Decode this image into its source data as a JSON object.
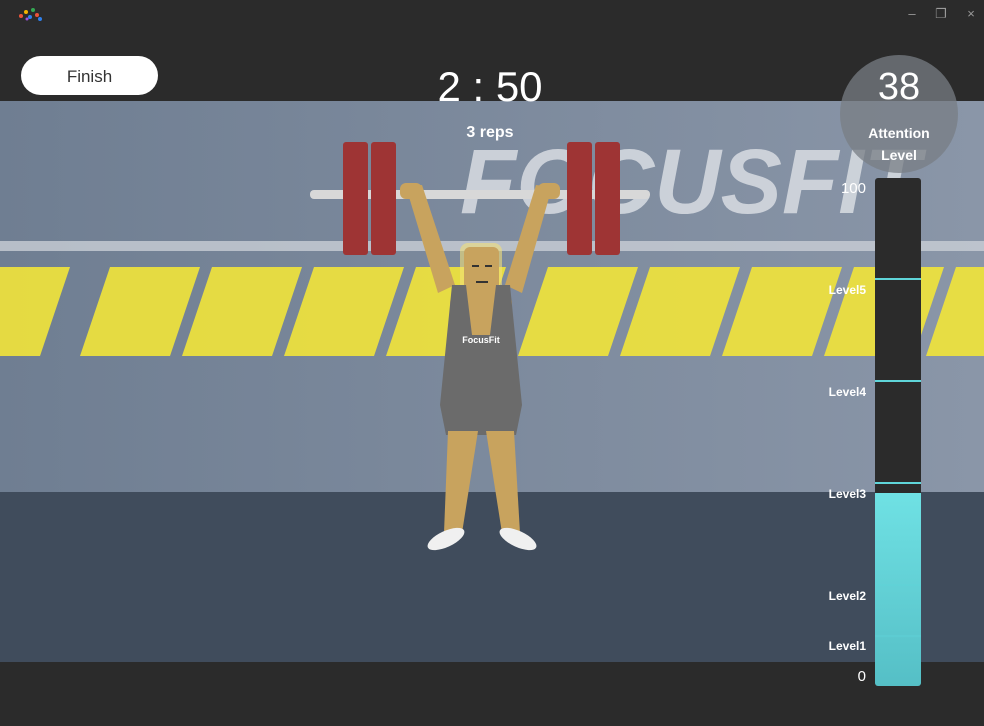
{
  "window": {
    "minimize_glyph": "–",
    "restore_glyph": "❐",
    "close_glyph": "×"
  },
  "game": {
    "finish_label": "Finish",
    "timer": "2 : 50",
    "reps": "3 reps",
    "banner_text": "FOCUSFIT",
    "shirt_text": "FocusFit"
  },
  "attention": {
    "value": "38",
    "label_line1": "Attention",
    "label_line2": "Level",
    "meter_fill_fraction": 0.38,
    "scale_max": "100",
    "scale_min": "0",
    "levels": [
      "Level5",
      "Level4",
      "Level3",
      "Level2",
      "Level1"
    ]
  },
  "colors": {
    "accent": "#6fe1e4",
    "plate": "#9e3434",
    "stripe": "#f2e53a",
    "skin": "#c8a35e",
    "singlet": "#6b6b6b"
  }
}
